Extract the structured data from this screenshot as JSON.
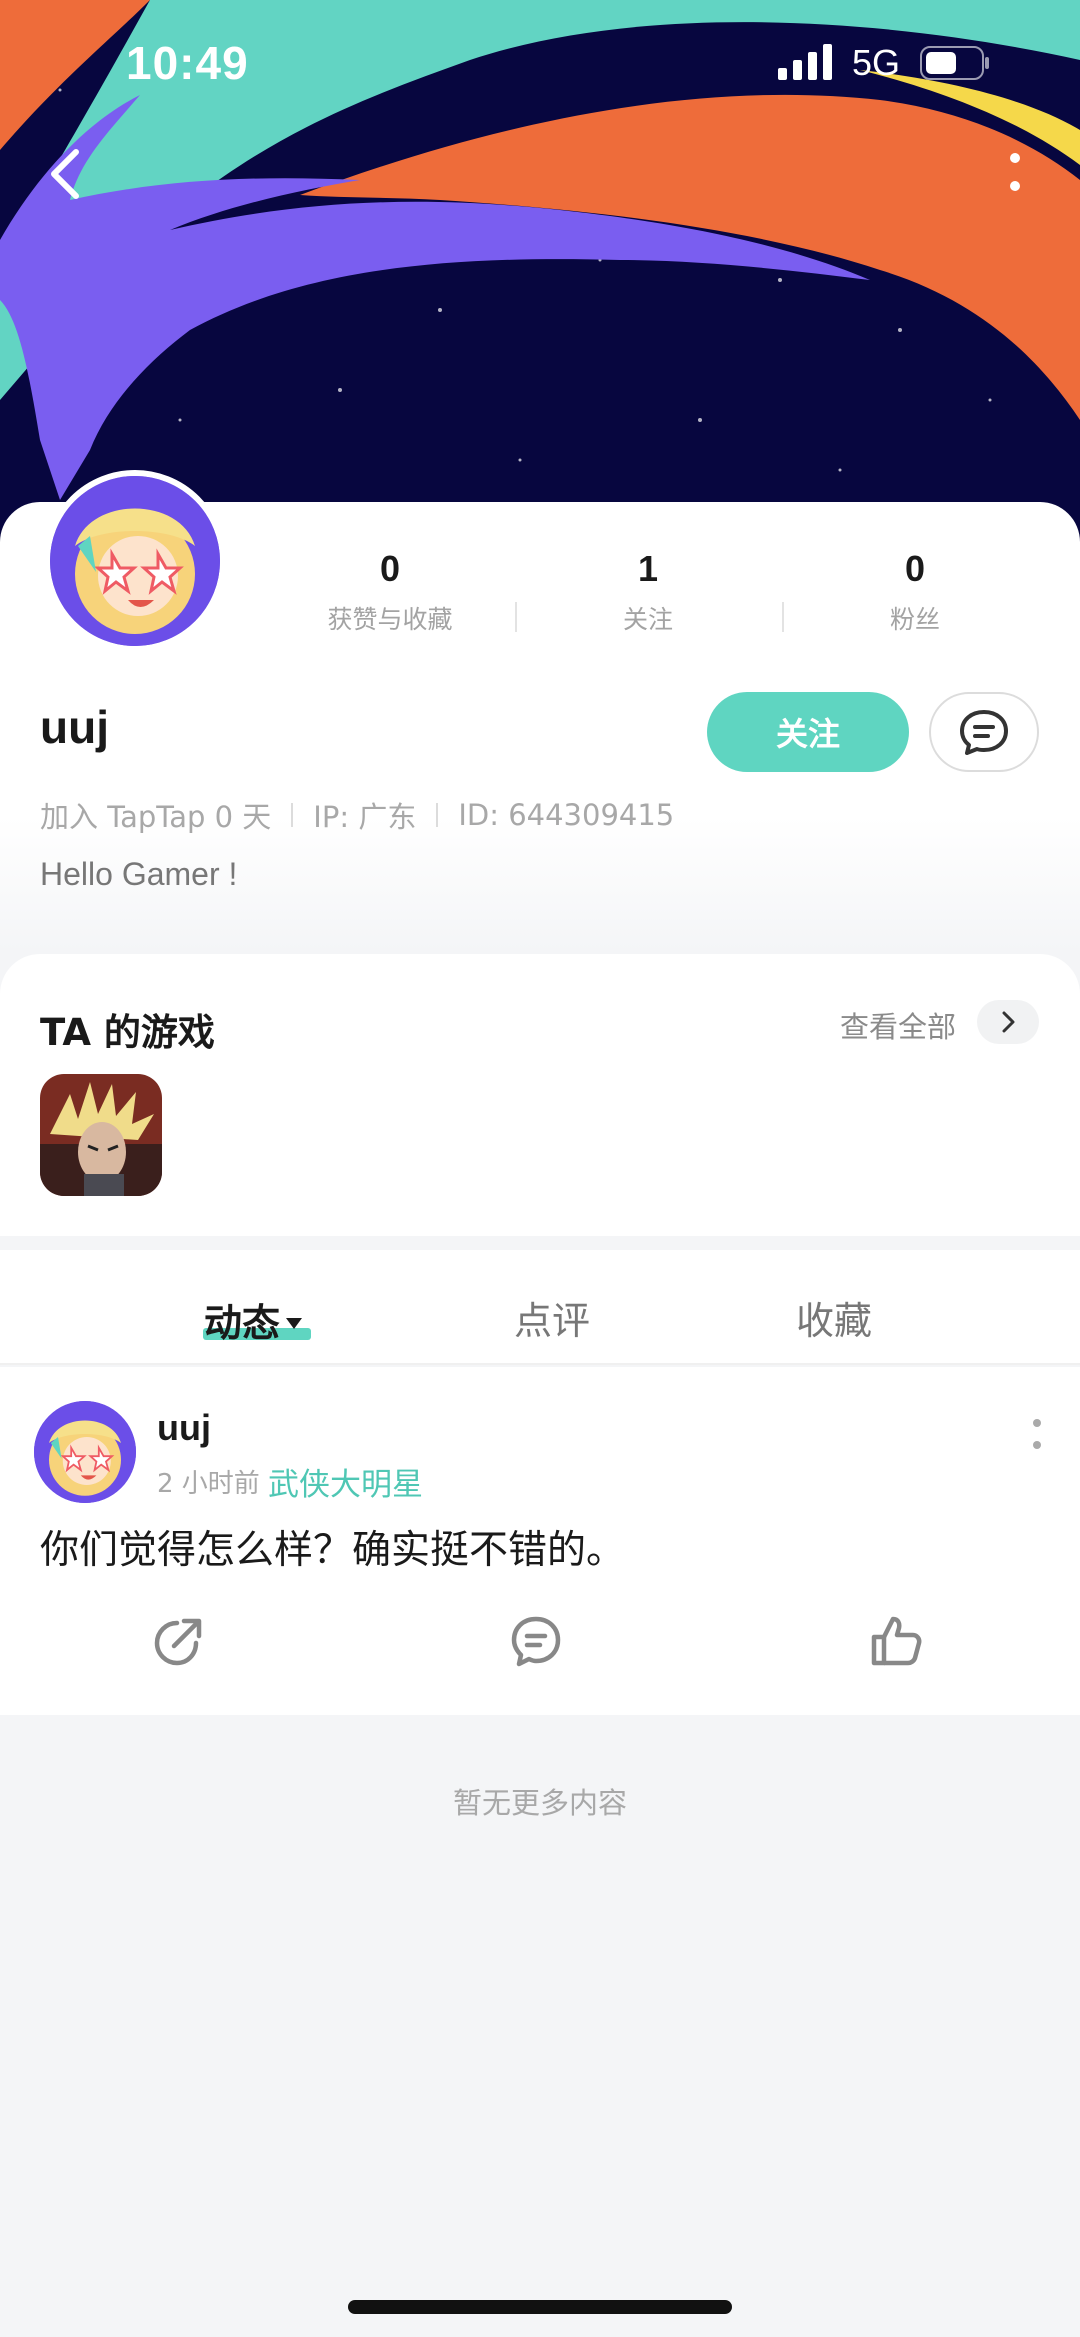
{
  "status_bar": {
    "time": "10:49",
    "network": "5G"
  },
  "profile": {
    "username": "uuj",
    "stats": [
      {
        "value": "0",
        "label": "获赞与收藏"
      },
      {
        "value": "1",
        "label": "关注"
      },
      {
        "value": "0",
        "label": "粉丝"
      }
    ],
    "follow_label": "关注",
    "meta": {
      "joined": "加入 TapTap 0 天",
      "ip": "IP: 广东",
      "id": "ID: 644309415"
    },
    "bio": "Hello Gamer !"
  },
  "games": {
    "title": "TA 的游戏",
    "view_all": "查看全部"
  },
  "tabs": [
    {
      "label": "动态"
    },
    {
      "label": "点评"
    },
    {
      "label": "收藏"
    }
  ],
  "post": {
    "author": "uuj",
    "time": "2 小时前",
    "game": "武侠大明星",
    "text": "你们觉得怎么样？确实挺不错的。"
  },
  "footer": {
    "no_more": "暂无更多内容"
  },
  "colors": {
    "accent": "#5fd5c1",
    "banner_bg": "#07063f",
    "stripe_purple": "#7a5ef0",
    "stripe_teal": "#62d4c3",
    "stripe_orange": "#ee6c3a",
    "stripe_yellow": "#f5d84a"
  }
}
